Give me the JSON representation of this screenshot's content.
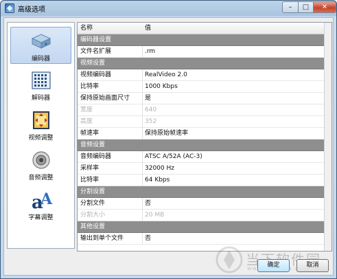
{
  "window": {
    "title": "高级选项",
    "close_glyph": "✕",
    "min_glyph": "–",
    "max_glyph": "□"
  },
  "sidebar": {
    "items": [
      {
        "label": "编码器",
        "icon": "encoder-icon",
        "active": true
      },
      {
        "label": "解码器",
        "icon": "decoder-icon",
        "active": false
      },
      {
        "label": "视频调整",
        "icon": "video-adjust-icon",
        "active": false
      },
      {
        "label": "音频调整",
        "icon": "audio-adjust-icon",
        "active": false
      },
      {
        "label": "字幕调整",
        "icon": "subtitle-adjust-icon",
        "active": false
      }
    ]
  },
  "table": {
    "headers": [
      "名称",
      "值"
    ],
    "rows": [
      {
        "type": "group",
        "name": "编码器设置"
      },
      {
        "type": "item",
        "name": "文件名扩展",
        "value": ".rm"
      },
      {
        "type": "group",
        "name": "视频设置"
      },
      {
        "type": "item",
        "name": "视频编码器",
        "value": "RealVideo 2.0"
      },
      {
        "type": "item",
        "name": "比特率",
        "value": "1000 Kbps"
      },
      {
        "type": "item",
        "name": "保持原始画面尺寸",
        "value": "是"
      },
      {
        "type": "disabled",
        "name": "宽度",
        "value": "640"
      },
      {
        "type": "disabled",
        "name": "高度",
        "value": "352"
      },
      {
        "type": "item",
        "name": "帧速率",
        "value": "保持原始帧速率"
      },
      {
        "type": "group",
        "name": "音频设置"
      },
      {
        "type": "item",
        "name": "音频编码器",
        "value": "ATSC A/52A (AC-3)"
      },
      {
        "type": "item",
        "name": "采样率",
        "value": "32000 Hz"
      },
      {
        "type": "item",
        "name": "比特率",
        "value": "64 Kbps"
      },
      {
        "type": "group",
        "name": "分割设置"
      },
      {
        "type": "item",
        "name": "分割文件",
        "value": "否"
      },
      {
        "type": "disabled",
        "name": "分割大小",
        "value": "20 MB"
      },
      {
        "type": "group",
        "name": "其他设置"
      },
      {
        "type": "item",
        "name": "输出到单个文件",
        "value": "否"
      }
    ]
  },
  "buttons": {
    "ok": "确定",
    "cancel": "取消"
  },
  "watermark": {
    "text": "当下软件园",
    "url": "www.downxia.com"
  }
}
